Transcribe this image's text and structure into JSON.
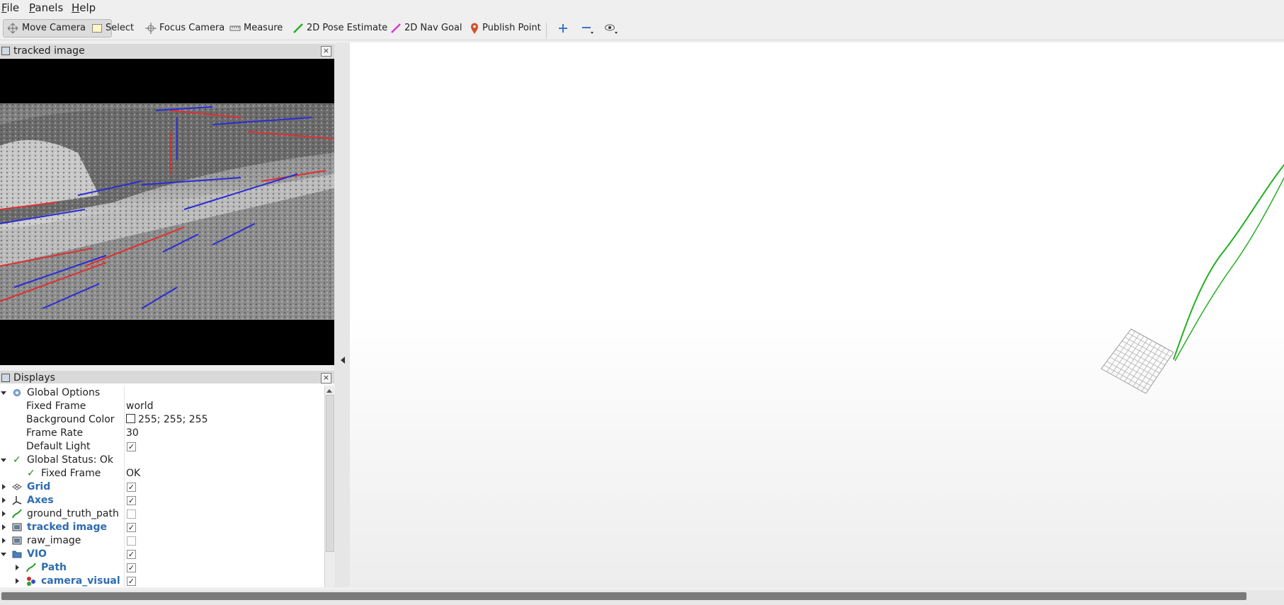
{
  "menu": {
    "file": {
      "first": "F",
      "rest": "ile"
    },
    "panels": {
      "first": "P",
      "rest": "anels"
    },
    "help": {
      "first": "H",
      "rest": "elp"
    }
  },
  "toolbar": {
    "move_camera": "Move Camera",
    "select": "Select",
    "focus_camera": "Focus Camera",
    "measure": "Measure",
    "pose_estimate": "2D Pose Estimate",
    "nav_goal": "2D Nav Goal",
    "publish_point": "Publish Point"
  },
  "tracked_image_panel": {
    "title": "tracked image"
  },
  "displays_panel": {
    "title": "Displays",
    "global_options": "Global Options",
    "fixed_frame": {
      "label": "Fixed Frame",
      "value": "world"
    },
    "background_color": {
      "label": "Background Color",
      "value": "255; 255; 255"
    },
    "frame_rate": {
      "label": "Frame Rate",
      "value": "30"
    },
    "default_light": {
      "label": "Default Light",
      "checked": true
    },
    "global_status": "Global Status: Ok",
    "status_fixed_frame": {
      "label": "Fixed Frame",
      "value": "OK"
    },
    "grid": {
      "label": "Grid",
      "checked": true
    },
    "axes": {
      "label": "Axes",
      "checked": true
    },
    "ground_truth_path": {
      "label": "ground_truth_path",
      "checked": false
    },
    "tracked_image": {
      "label": "tracked image",
      "checked": true
    },
    "raw_image": {
      "label": "raw_image",
      "checked": false
    },
    "vio": {
      "label": "VIO",
      "checked": true
    },
    "path": {
      "label": "Path",
      "checked": true
    },
    "camera_visual": {
      "label": "camera_visual",
      "checked": true
    }
  },
  "colors": {
    "path_green": "#22b022",
    "label_blue": "#2d6cb0",
    "feature_red": "#e03030",
    "feature_blue": "#2b2bd8"
  }
}
